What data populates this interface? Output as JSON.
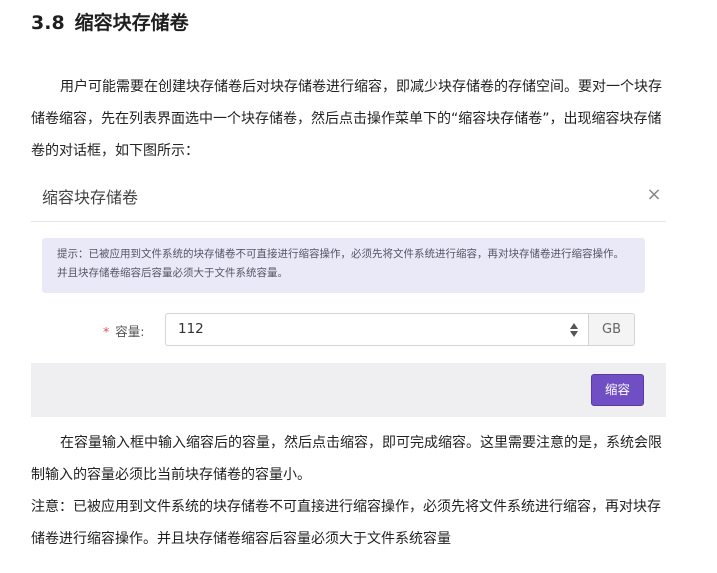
{
  "section": {
    "number": "3.8",
    "title": "缩容块存储卷"
  },
  "intro_paragraph": "用户可能需要在创建块存储卷后对块存储卷进行缩容，即减少块存储卷的存储空间。要对一个块存储卷缩容，先在列表界面选中一个块存储卷，然后点击操作菜单下的“缩容块存储卷”，出现缩容块存储卷的对话框，如下图所示：",
  "dialog": {
    "title": "缩容块存储卷",
    "close_symbol": "×",
    "alert_text": "提示：已被应用到文件系统的块存储卷不可直接进行缩容操作，必须先将文件系统进行缩容，再对块存储卷进行缩容操作。并且块存储卷缩容后容量必须大于文件系统容量。",
    "form": {
      "required_mark": "*",
      "capacity_label": "容量:",
      "capacity_value": "112",
      "unit": "GB"
    },
    "submit_label": "缩容",
    "colors": {
      "primary": "#6f4fc3",
      "alert_bg": "#e9e9f7",
      "footer_bg": "#efeff2"
    }
  },
  "after_paragraph": "在容量输入框中输入缩容后的容量，然后点击缩容，即可完成缩容。这里需要注意的是，系统会限制输入的容量必须比当前块存储卷的容量小。",
  "note_paragraph": "注意：已被应用到文件系统的块存储卷不可直接进行缩容操作，必须先将文件系统进行缩容，再对块存储卷进行缩容操作。并且块存储卷缩容后容量必须大于文件系统容量"
}
